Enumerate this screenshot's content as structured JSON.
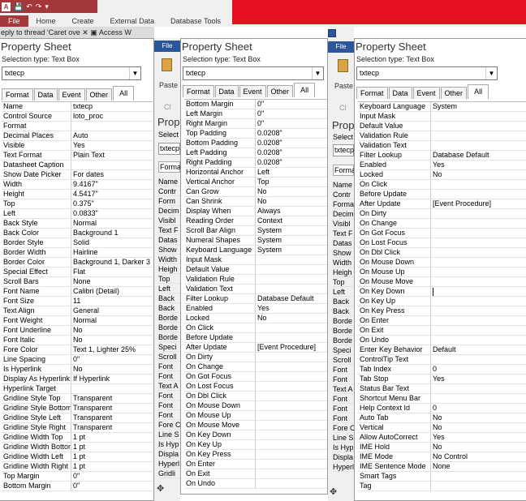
{
  "window": {
    "app_letter": "A",
    "ribbon_tabs": [
      "File",
      "Home",
      "Create",
      "External Data",
      "Database Tools"
    ],
    "address": "eply to thread 'Caret ove",
    "browser_tab": "Access W"
  },
  "sheet1": {
    "title": "Property Sheet",
    "selection_type": "Selection type:  Text Box",
    "combo": "txtecp",
    "tabs": [
      "Format",
      "Data",
      "Event",
      "Other",
      "All"
    ],
    "rows": [
      [
        "Name",
        "txtecp"
      ],
      [
        "Control Source",
        "loto_proc"
      ],
      [
        "Format",
        ""
      ],
      [
        "Decimal Places",
        "Auto"
      ],
      [
        "Visible",
        "Yes"
      ],
      [
        "Text Format",
        "Plain Text"
      ],
      [
        "Datasheet Caption",
        ""
      ],
      [
        "Show Date Picker",
        "For dates"
      ],
      [
        "Width",
        "9.4167\""
      ],
      [
        "Height",
        "4.5417\""
      ],
      [
        "Top",
        "0.375\""
      ],
      [
        "Left",
        "0.0833\""
      ],
      [
        "Back Style",
        "Normal"
      ],
      [
        "Back Color",
        "Background 1"
      ],
      [
        "Border Style",
        "Solid"
      ],
      [
        "Border Width",
        "Hairline"
      ],
      [
        "Border Color",
        "Background 1, Darker 3"
      ],
      [
        "Special Effect",
        "Flat"
      ],
      [
        "Scroll Bars",
        "None"
      ],
      [
        "Font Name",
        "Calibri (Detail)"
      ],
      [
        "Font Size",
        "11"
      ],
      [
        "Text Align",
        "General"
      ],
      [
        "Font Weight",
        "Normal"
      ],
      [
        "Font Underline",
        "No"
      ],
      [
        "Font Italic",
        "No"
      ],
      [
        "Fore Color",
        "Text 1, Lighter 25%"
      ],
      [
        "Line Spacing",
        "0\""
      ],
      [
        "Is Hyperlink",
        "No"
      ],
      [
        "Display As Hyperlink",
        "If Hyperlink"
      ],
      [
        "Hyperlink Target",
        ""
      ],
      [
        "Gridline Style Top",
        "Transparent"
      ],
      [
        "Gridline Style Bottom",
        "Transparent"
      ],
      [
        "Gridline Style Left",
        "Transparent"
      ],
      [
        "Gridline Style Right",
        "Transparent"
      ],
      [
        "Gridline Width Top",
        "1 pt"
      ],
      [
        "Gridline Width Bottom",
        "1 pt"
      ],
      [
        "Gridline Width Left",
        "1 pt"
      ],
      [
        "Gridline Width Right",
        "1 pt"
      ],
      [
        "Top Margin",
        "0\""
      ],
      [
        "Bottom Margin",
        "0\""
      ]
    ]
  },
  "strip1": {
    "file_label": "File",
    "paste_label": "Paste",
    "clip_label": "Cl",
    "prop_label": "Prop",
    "sel_label": "Select",
    "combo": "txtecp",
    "format_label": "Forma",
    "lines": [
      "Name",
      "Contr",
      "Form",
      "Decim",
      "Visibl",
      "Text F",
      "Datas",
      "Show",
      "Width",
      "Heigh",
      "Top",
      "Left",
      "Back",
      "Back",
      "Borde",
      "Borde",
      "Borde",
      "Speci",
      "Scroll",
      "Font",
      "Font",
      "Text A",
      "Font",
      "Font",
      "Font",
      "Fore C",
      "Line S",
      "Is Hyp",
      "Displa",
      "Hyperl",
      "Gridli"
    ]
  },
  "sheet2": {
    "title": "Property Sheet",
    "selection_type": "Selection type:  Text Box",
    "combo": "txtecp",
    "tabs": [
      "Format",
      "Data",
      "Event",
      "Other",
      "All"
    ],
    "rows": [
      [
        "Bottom Margin",
        "0\""
      ],
      [
        "Left Margin",
        "0\""
      ],
      [
        "Right Margin",
        "0\""
      ],
      [
        "Top Padding",
        "0.0208\""
      ],
      [
        "Bottom Padding",
        "0.0208\""
      ],
      [
        "Left Padding",
        "0.0208\""
      ],
      [
        "Right Padding",
        "0.0208\""
      ],
      [
        "Horizontal Anchor",
        "Left"
      ],
      [
        "Vertical Anchor",
        "Top"
      ],
      [
        "Can Grow",
        "No"
      ],
      [
        "Can Shrink",
        "No"
      ],
      [
        "Display When",
        "Always"
      ],
      [
        "Reading Order",
        "Context"
      ],
      [
        "Scroll Bar Align",
        "System"
      ],
      [
        "Numeral Shapes",
        "System"
      ],
      [
        "Keyboard Language",
        "System"
      ],
      [
        "Input Mask",
        ""
      ],
      [
        "Default Value",
        ""
      ],
      [
        "Validation Rule",
        ""
      ],
      [
        "Validation Text",
        ""
      ],
      [
        "Filter Lookup",
        "Database Default"
      ],
      [
        "Enabled",
        "Yes"
      ],
      [
        "Locked",
        "No"
      ],
      [
        "On Click",
        ""
      ],
      [
        "Before Update",
        ""
      ],
      [
        "After Update",
        "[Event Procedure]"
      ],
      [
        "On Dirty",
        ""
      ],
      [
        "On Change",
        ""
      ],
      [
        "On Got Focus",
        ""
      ],
      [
        "On Lost Focus",
        ""
      ],
      [
        "On Dbl Click",
        ""
      ],
      [
        "On Mouse Down",
        ""
      ],
      [
        "On Mouse Up",
        ""
      ],
      [
        "On Mouse Move",
        ""
      ],
      [
        "On Key Down",
        ""
      ],
      [
        "On Key Up",
        ""
      ],
      [
        "On Key Press",
        ""
      ],
      [
        "On Enter",
        ""
      ],
      [
        "On Exit",
        ""
      ],
      [
        "On Undo",
        ""
      ]
    ]
  },
  "strip2": {
    "file_label": "File",
    "paste_label": "Paste",
    "clip_label": "Cl",
    "prop_label": "Prop",
    "sel_label": "Select",
    "combo": "txtecp",
    "format_label": "Forma",
    "lines": [
      "Name",
      "Contr",
      "Forma",
      "Decim",
      "Visibl",
      "Text F",
      "Datas",
      "Show",
      "Width",
      "Heigh",
      "Top",
      "Left",
      "Back",
      "Back",
      "Borde",
      "Borde",
      "Borde",
      "Speci",
      "Scroll",
      "Font",
      "Font",
      "Text A",
      "Font",
      "Font",
      "Font",
      "Fore C",
      "Line S",
      "Is Hyp",
      "Displa",
      "Hyperl"
    ]
  },
  "sheet3": {
    "title": "Property Sheet",
    "selection_type": "Selection type:  Text Box",
    "combo": "txtecp",
    "tabs": [
      "Format",
      "Data",
      "Event",
      "Other",
      "All"
    ],
    "rows": [
      [
        "Keyboard Language",
        "System"
      ],
      [
        "Input Mask",
        ""
      ],
      [
        "Default Value",
        ""
      ],
      [
        "Validation Rule",
        ""
      ],
      [
        "Validation Text",
        ""
      ],
      [
        "Filter Lookup",
        "Database Default"
      ],
      [
        "Enabled",
        "Yes"
      ],
      [
        "Locked",
        "No"
      ],
      [
        "On Click",
        ""
      ],
      [
        "Before Update",
        ""
      ],
      [
        "After Update",
        "[Event Procedure]"
      ],
      [
        "On Dirty",
        ""
      ],
      [
        "On Change",
        ""
      ],
      [
        "On Got Focus",
        ""
      ],
      [
        "On Lost Focus",
        ""
      ],
      [
        "On Dbl Click",
        ""
      ],
      [
        "On Mouse Down",
        ""
      ],
      [
        "On Mouse Up",
        ""
      ],
      [
        "On Mouse Move",
        ""
      ],
      [
        "On Key Down",
        ""
      ],
      [
        "On Key Up",
        ""
      ],
      [
        "On Key Press",
        ""
      ],
      [
        "On Enter",
        ""
      ],
      [
        "On Exit",
        ""
      ],
      [
        "On Undo",
        ""
      ],
      [
        "Enter Key Behavior",
        "Default"
      ],
      [
        "ControlTip Text",
        ""
      ],
      [
        "Tab Index",
        "0"
      ],
      [
        "Tab Stop",
        "Yes"
      ],
      [
        "Status Bar Text",
        ""
      ],
      [
        "Shortcut Menu Bar",
        ""
      ],
      [
        "Help Context Id",
        "0"
      ],
      [
        "Auto Tab",
        "No"
      ],
      [
        "Vertical",
        "No"
      ],
      [
        "Allow AutoCorrect",
        "Yes"
      ],
      [
        "IME Hold",
        "No"
      ],
      [
        "IME Mode",
        "No Control"
      ],
      [
        "IME Sentence Mode",
        "None"
      ],
      [
        "Smart Tags",
        ""
      ],
      [
        "Tag",
        ""
      ]
    ]
  }
}
